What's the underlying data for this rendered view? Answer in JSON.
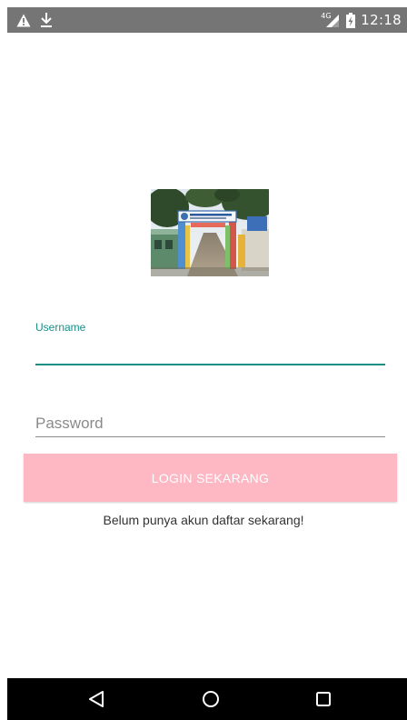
{
  "status_bar": {
    "time": "12:18",
    "network": "4G",
    "icons": [
      "warning-icon",
      "download-icon",
      "signal-icon",
      "battery-icon"
    ]
  },
  "logo": {
    "description_icon": "school-gate-photo",
    "banner_text": "SMK NEGERI 1"
  },
  "form": {
    "username_label": "Username",
    "username_value": "",
    "password_placeholder": "Password",
    "password_value": "",
    "accent_color": "#178f86"
  },
  "login_button": {
    "label": "LOGIN SEKARANG",
    "color": "#fdb8c3"
  },
  "register_link": {
    "text": "Belum punya akun daftar sekarang!"
  },
  "nav_bar": {
    "icons": [
      "back-icon",
      "home-icon",
      "recents-icon"
    ]
  }
}
